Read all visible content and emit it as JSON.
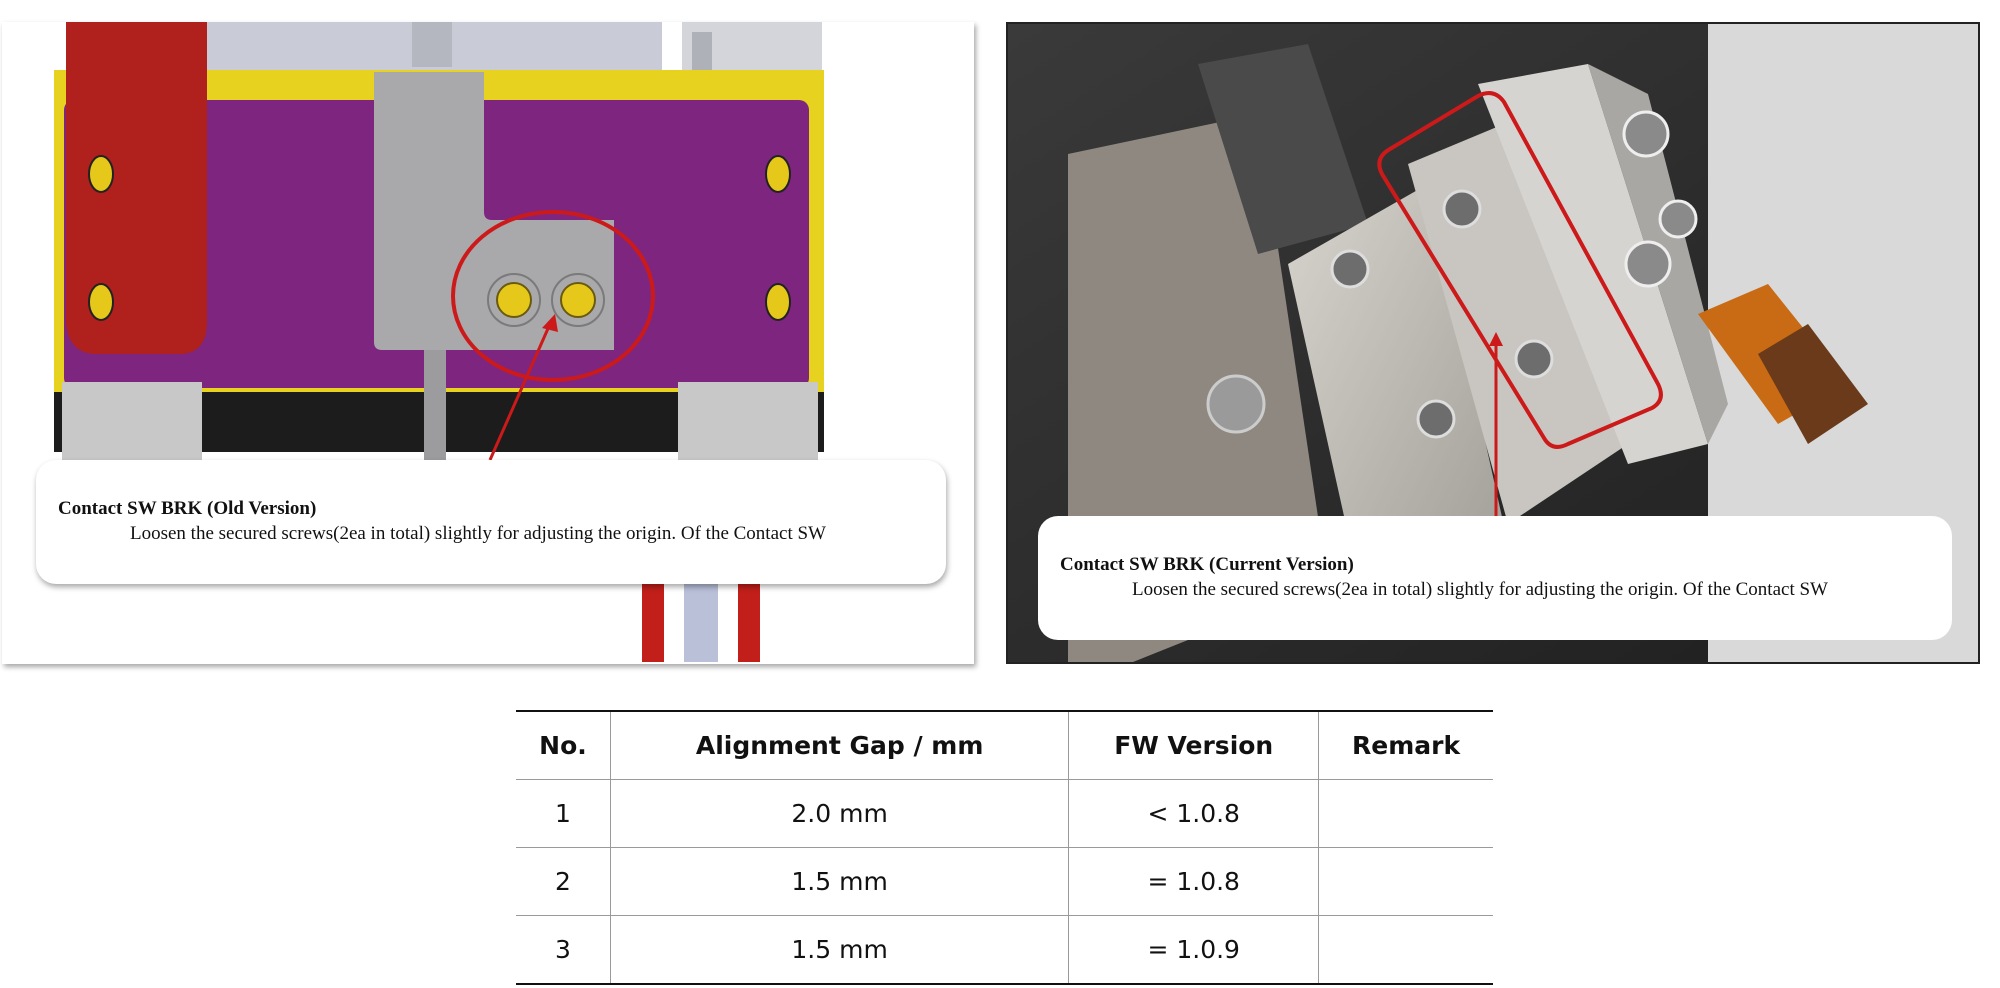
{
  "figures": [
    {
      "title": "Contact SW BRK (Old Version)",
      "description": "Loosen the secured screws(2ea in total) slightly for adjusting the origin. Of the Contact SW"
    },
    {
      "title": "Contact SW BRK (Current Version)",
      "description": "Loosen the secured screws(2ea in total) slightly for adjusting the origin. Of the Contact SW"
    }
  ],
  "table": {
    "headers": [
      "No.",
      "Alignment Gap / mm",
      "FW Version",
      "Remark"
    ],
    "rows": [
      [
        "1",
        "2.0 mm",
        "< 1.0.8",
        ""
      ],
      [
        "2",
        "1.5 mm",
        "= 1.0.8",
        ""
      ],
      [
        "3",
        "1.5 mm",
        "= 1.0.9",
        ""
      ]
    ]
  },
  "colors": {
    "purple_plate": "#7e2580",
    "yellow_frame": "#e6d21f",
    "red_bracket": "#b0201c",
    "annotation_red": "#cc1a1a"
  }
}
